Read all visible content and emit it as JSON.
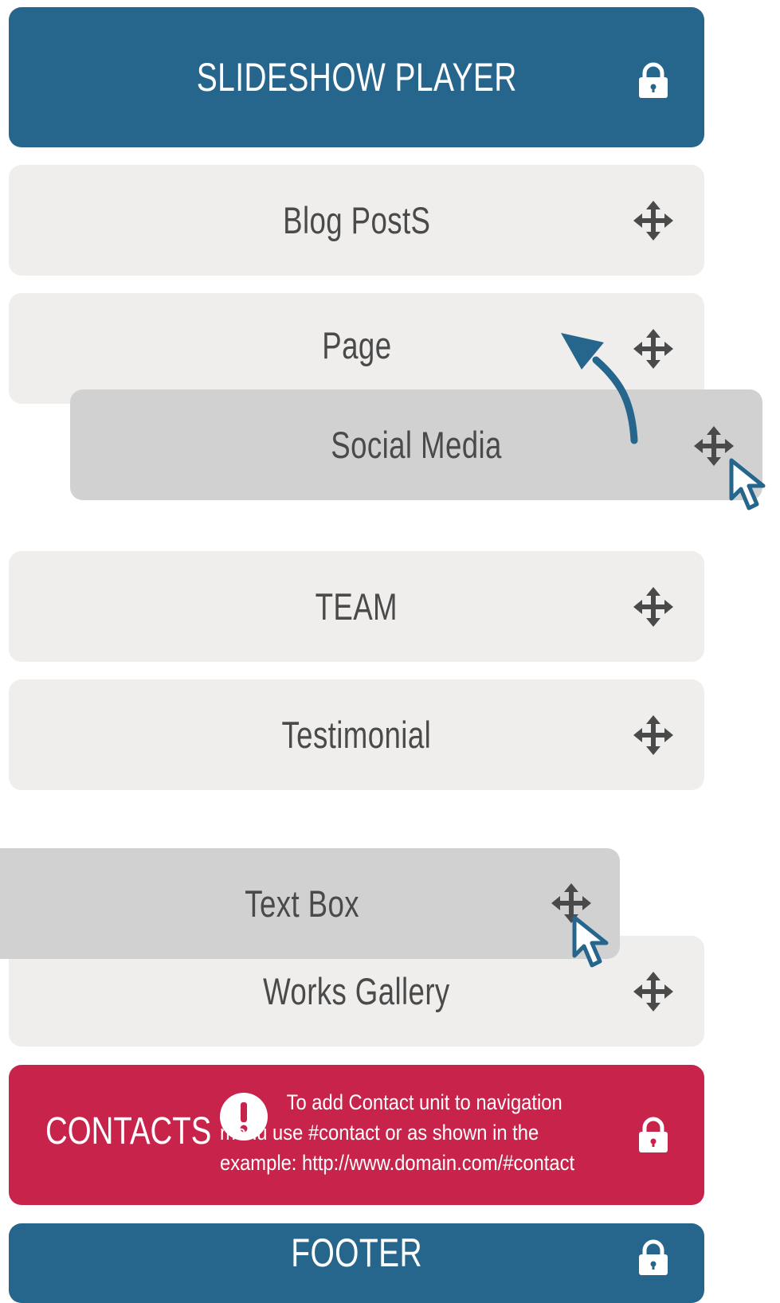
{
  "header": {
    "title": "SLIDESHOW PLAYER",
    "icon": "lock-icon"
  },
  "items": [
    {
      "label": "Blog PostS",
      "icon": "move-icon"
    },
    {
      "label": "Page",
      "icon": "move-icon"
    },
    {
      "label": "Social Media",
      "icon": "move-icon",
      "state": "dragging"
    },
    {
      "label": "TEAM",
      "icon": "move-icon"
    },
    {
      "label": "Testimonial",
      "icon": "move-icon"
    },
    {
      "label": "Text Box",
      "icon": "move-icon",
      "state": "dragging"
    },
    {
      "label": "Works Gallery",
      "icon": "move-icon"
    }
  ],
  "contacts": {
    "title": "CONTACTS",
    "message": "To add Contact unit to navigation menu use #contact or as shown in the example: http://www.domain.com/#contact",
    "alert_icon": "exclamation-icon",
    "icon": "lock-icon"
  },
  "footer": {
    "title": "FOOTER",
    "icon": "lock-icon"
  },
  "colors": {
    "locked": "#26658c",
    "item": "#efeeed",
    "dragging": "#d2d1d1",
    "contacts": "#c7234b",
    "text": "#4a4a4a"
  }
}
